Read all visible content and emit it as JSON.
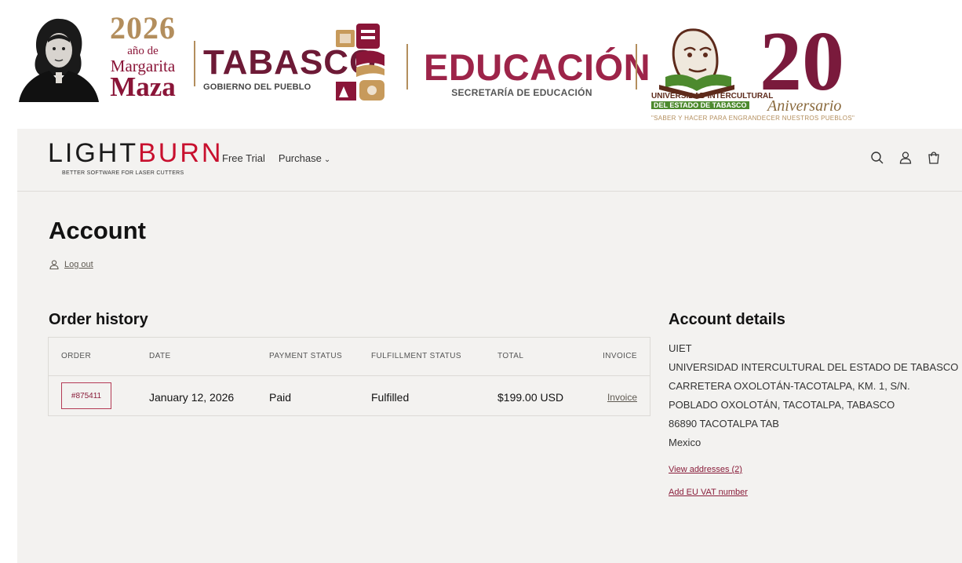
{
  "banner": {
    "year": "2026",
    "year_sub": "año de",
    "honoree_first": "Margarita",
    "honoree_last": "Maza",
    "state_name": "TABASCO",
    "state_sub": "GOBIERNO DEL PUEBLO",
    "dept_name": "EDUCACIÓN",
    "dept_sub": "SECRETARÍA DE EDUCACIÓN",
    "uni_name": "UNIVERSIDAD INTERCULTURAL",
    "uni_sub": "DEL ESTADO DE TABASCO",
    "uni_slogan": "\"SABER Y HACER PARA ENGRANDECER NUESTROS PUEBLOS\"",
    "anniversary_number": "20",
    "anniversary_word": "Aniversario",
    "colors": {
      "guinda": "#8a1538",
      "gold": "#b38e5d",
      "green": "#4d8a2e"
    }
  },
  "header": {
    "logo_light": "LIGHT",
    "logo_burn": "BURN",
    "logo_tagline": "BETTER SOFTWARE FOR LASER CUTTERS",
    "nav": {
      "free_trial": "Free Trial",
      "purchase": "Purchase"
    },
    "icons": [
      "search-icon",
      "account-icon",
      "cart-icon"
    ]
  },
  "account": {
    "title": "Account",
    "logout_label": "Log out"
  },
  "order_history": {
    "title": "Order history",
    "columns": {
      "order": "ORDER",
      "date": "DATE",
      "payment_status": "PAYMENT STATUS",
      "fulfillment_status": "FULFILLMENT STATUS",
      "total": "TOTAL",
      "invoice": "INVOICE"
    },
    "rows": [
      {
        "order": "#875411",
        "date": "January 12, 2026",
        "payment_status": "Paid",
        "fulfillment_status": "Fulfilled",
        "total": "$199.00 USD",
        "invoice": "Invoice"
      }
    ]
  },
  "account_details": {
    "title": "Account details",
    "lines": [
      "UIET",
      "UNIVERSIDAD INTERCULTURAL DEL ESTADO DE TABASCO",
      "CARRETERA OXOLOTÁN-TACOTALPA, KM. 1, S/N.",
      "POBLADO OXOLOTÁN, TACOTALPA, TABASCO",
      "86890 TACOTALPA TAB",
      "Mexico"
    ],
    "view_addresses": "View addresses (2)",
    "add_vat": "Add EU VAT number"
  }
}
